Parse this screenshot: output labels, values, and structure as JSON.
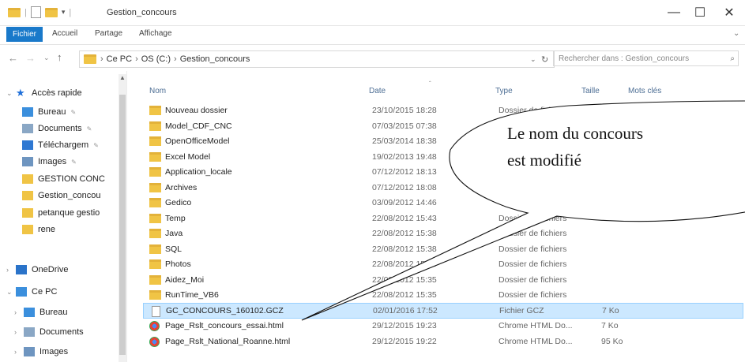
{
  "window": {
    "title": "Gestion_concours",
    "minimize": "—",
    "maximize": "☐",
    "close": "✕"
  },
  "ribbon": {
    "tabs": [
      "Fichier",
      "Accueil",
      "Partage",
      "Affichage"
    ]
  },
  "address": {
    "crumbs": [
      "Ce PC",
      "OS (C:)",
      "Gestion_concours"
    ],
    "search_placeholder": "Rechercher dans : Gestion_concours"
  },
  "nav": {
    "items": [
      {
        "label": "Accès rapide",
        "icon": "star-icon",
        "color": "#1e6fd9"
      },
      {
        "label": "Bureau",
        "icon": "desktop-icon",
        "color": "#3b8fdd"
      },
      {
        "label": "Documents",
        "icon": "document-icon",
        "color": "#8aa7c5"
      },
      {
        "label": "Téléchargem",
        "icon": "download-icon",
        "color": "#2e78d2"
      },
      {
        "label": "Images",
        "icon": "images-icon",
        "color": "#6e95c0"
      },
      {
        "label": "GESTION CONC",
        "icon": "folder-icon",
        "color": "#f0c445"
      },
      {
        "label": "Gestion_concou",
        "icon": "folder-icon",
        "color": "#f0c445"
      },
      {
        "label": "petanque gestio",
        "icon": "folder-icon",
        "color": "#f0c445"
      },
      {
        "label": "rene",
        "icon": "folder-icon",
        "color": "#f0c445"
      },
      {
        "label": "OneDrive",
        "icon": "cloud-icon",
        "color": "#2a73c9"
      },
      {
        "label": "Ce PC",
        "icon": "pc-icon",
        "color": "#3b8fdd"
      },
      {
        "label": "Bureau",
        "icon": "desktop-icon",
        "color": "#3b8fdd"
      },
      {
        "label": "Documents",
        "icon": "document-icon",
        "color": "#8aa7c5"
      },
      {
        "label": "Images",
        "icon": "images-icon",
        "color": "#6e95c0"
      }
    ]
  },
  "columns": {
    "name": "Nom",
    "date": "Date",
    "type": "Type",
    "size": "Taille",
    "tags": "Mots clés"
  },
  "files": [
    {
      "name": "Nouveau dossier",
      "date": "23/10/2015 18:28",
      "type": "Dossier de fichiers",
      "size": "",
      "kind": "folder"
    },
    {
      "name": "Model_CDF_CNC",
      "date": "07/03/2015 07:38",
      "type": "",
      "size": "",
      "kind": "folder"
    },
    {
      "name": "OpenOfficeModel",
      "date": "25/03/2014 18:38",
      "type": "",
      "size": "",
      "kind": "folder"
    },
    {
      "name": "Excel Model",
      "date": "19/02/2013 19:48",
      "type": "",
      "size": "",
      "kind": "folder"
    },
    {
      "name": "Application_locale",
      "date": "07/12/2012 18:13",
      "type": "",
      "size": "",
      "kind": "folder"
    },
    {
      "name": "Archives",
      "date": "07/12/2012 18:08",
      "type": "",
      "size": "",
      "kind": "folder"
    },
    {
      "name": "Gedico",
      "date": "03/09/2012 14:46",
      "type": "",
      "size": "",
      "kind": "folder"
    },
    {
      "name": "Temp",
      "date": "22/08/2012 15:43",
      "type": "Dossier de fichiers",
      "size": "",
      "kind": "folder"
    },
    {
      "name": "Java",
      "date": "22/08/2012 15:38",
      "type": "Dossier de fichiers",
      "size": "",
      "kind": "folder"
    },
    {
      "name": "SQL",
      "date": "22/08/2012 15:38",
      "type": "Dossier de fichiers",
      "size": "",
      "kind": "folder"
    },
    {
      "name": "Photos",
      "date": "22/08/2012 15:38",
      "type": "Dossier de fichiers",
      "size": "",
      "kind": "folder"
    },
    {
      "name": "Aidez_Moi",
      "date": "22/08/2012 15:35",
      "type": "Dossier de fichiers",
      "size": "",
      "kind": "folder"
    },
    {
      "name": "RunTime_VB6",
      "date": "22/08/2012 15:35",
      "type": "Dossier de fichiers",
      "size": "",
      "kind": "folder"
    },
    {
      "name": "GC_CONCOURS_160102.GCZ",
      "date": "02/01/2016 17:52",
      "type": "Fichier GCZ",
      "size": "7 Ko",
      "kind": "file"
    },
    {
      "name": "Page_Rslt_concours_essai.html",
      "date": "29/12/2015 19:23",
      "type": "Chrome HTML Do...",
      "size": "7 Ko",
      "kind": "chrome"
    },
    {
      "name": "Page_Rslt_National_Roanne.html",
      "date": "29/12/2015 19:22",
      "type": "Chrome HTML Do...",
      "size": "95 Ko",
      "kind": "chrome"
    }
  ],
  "callout": {
    "line1": "Le nom du concours",
    "line2": "est modifié"
  }
}
